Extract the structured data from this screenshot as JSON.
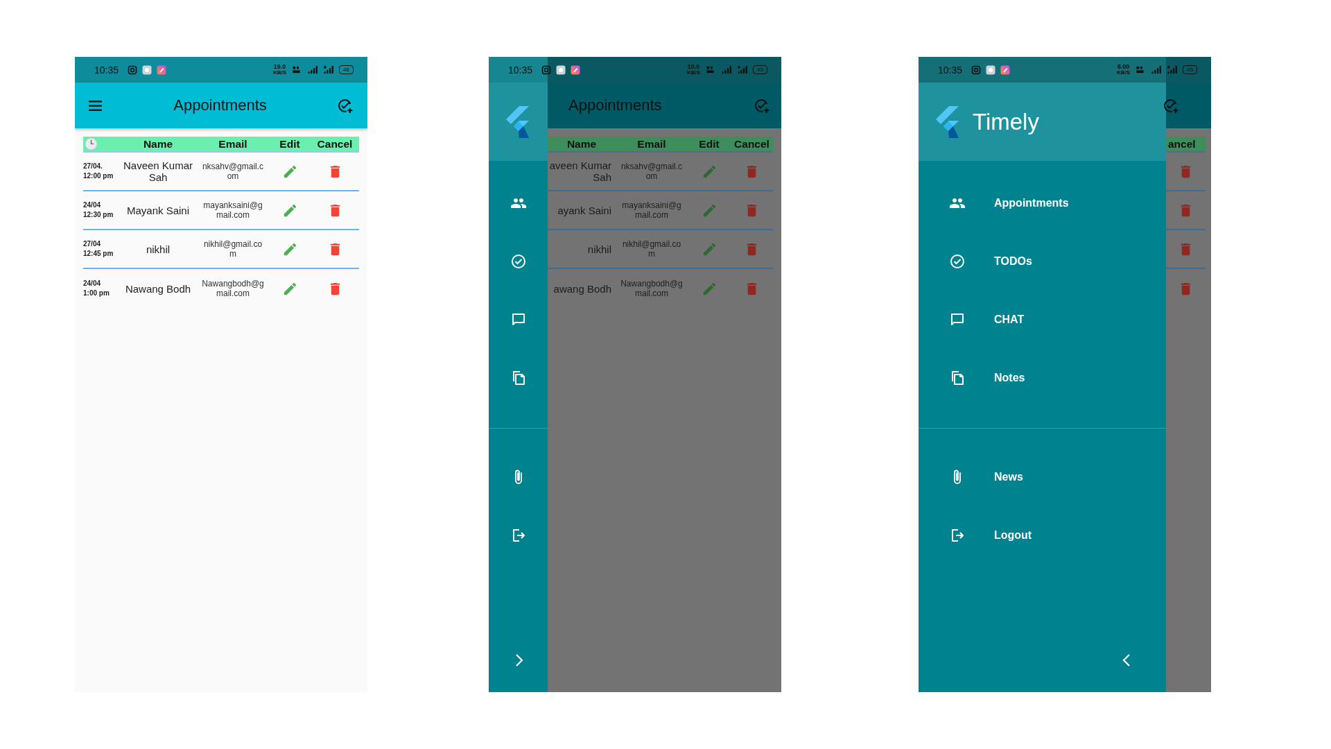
{
  "screens": [
    {
      "status_bar": {
        "time": "10:35",
        "speed": "19.0",
        "speed_unit": "KB/S",
        "battery": "46"
      },
      "app_bar": {
        "title": "Appointments"
      },
      "table": {
        "columns": [
          "Name",
          "Email",
          "Edit",
          "Cancel"
        ],
        "rows": [
          {
            "kind": "entry",
            "date": "27/04.",
            "time": "12:00 pm",
            "name": "Naveen Kumar Sah",
            "email": "nksahv@gmail.com"
          },
          {
            "kind": "entry",
            "date": "24/04",
            "time": "12:30 pm",
            "name": "Mayank Saini",
            "email": "mayanksaini@gmail.com"
          },
          {
            "kind": "entry",
            "date": "27/04",
            "time": "12:45 pm",
            "name": "nikhil",
            "email": "nikhil@gmail.com"
          },
          {
            "kind": "entry",
            "date": "24/04",
            "time": "1:00 pm",
            "name": "Nawang Bodh",
            "email": "Nawangbodh@gmail.com"
          }
        ]
      }
    },
    {
      "status_bar": {
        "time": "10:35",
        "speed": "10.0",
        "speed_unit": "KB/S",
        "battery": "45"
      },
      "app_bar": {
        "title": "Appointments"
      },
      "drawer": {
        "expanded": false
      },
      "table": {
        "columns": [
          "Name",
          "Email",
          "Edit",
          "Cancel"
        ],
        "rows": [
          {
            "kind": "entry",
            "name": "aveen Kumar Sah",
            "email": "nksahv@gmail.com"
          },
          {
            "kind": "entry",
            "name": "ayank Saini",
            "email": "mayanksaini@gmail.com"
          },
          {
            "kind": "entry",
            "name": "nikhil",
            "email": "nikhil@gmail.com"
          },
          {
            "kind": "entry",
            "name": "awang Bodh",
            "email": "Nawangbodh@gmail.com"
          }
        ]
      }
    },
    {
      "status_bar": {
        "time": "10:35",
        "speed": "8.00",
        "speed_unit": "KB/S",
        "battery": "45"
      },
      "drawer": {
        "expanded": true,
        "title": "Timely",
        "items": [
          {
            "label": "Appointments"
          },
          {
            "label": "TODOs"
          },
          {
            "label": "CHAT"
          },
          {
            "label": "Notes"
          },
          {
            "label": "News"
          },
          {
            "label": "Logout"
          }
        ]
      },
      "table": {
        "columns": [
          "ancel"
        ],
        "rows": [
          {
            "kind": "delete"
          },
          {
            "kind": "delete"
          },
          {
            "kind": "delete"
          },
          {
            "kind": "delete"
          }
        ]
      }
    }
  ]
}
